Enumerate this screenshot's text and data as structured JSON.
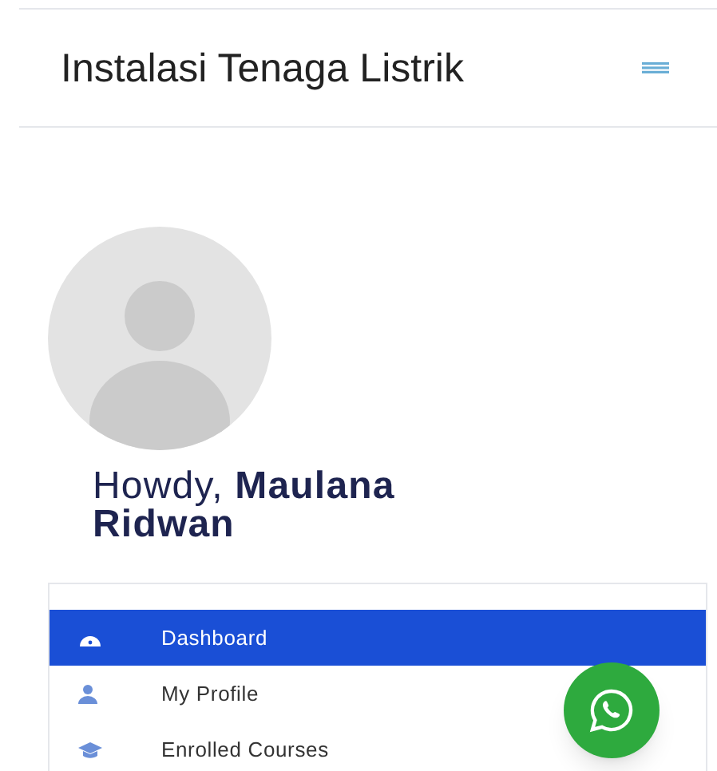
{
  "header": {
    "title": "Instalasi Tenaga Listrik"
  },
  "profile": {
    "greeting": "Howdy, **Maulana Ridwan**"
  },
  "menu": [
    {
      "label": "Dashboard",
      "selected": true
    },
    {
      "label": "My Profile",
      "selected": false
    },
    {
      "label": "Enrolled Courses",
      "selected": false
    }
  ]
}
